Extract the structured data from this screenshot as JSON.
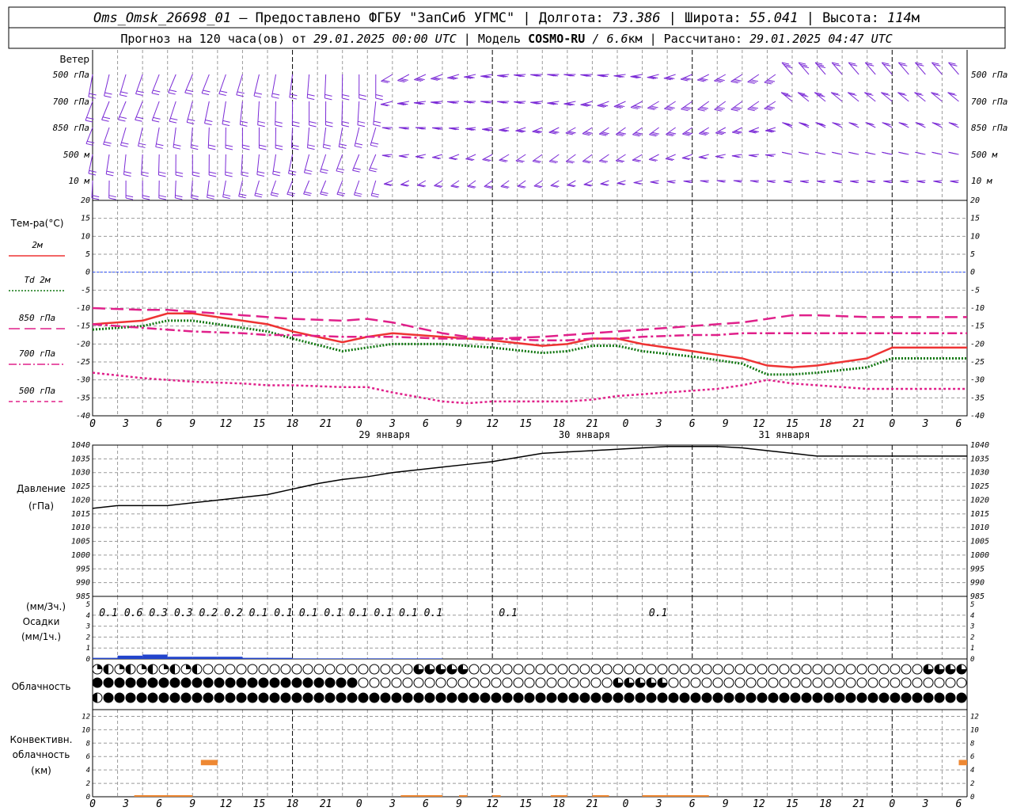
{
  "header": {
    "line1": [
      {
        "t": "Oms_Omsk_26698_01",
        "it": true
      },
      {
        "t": " – Предоставлено ФГБУ \"ЗапСиб УГМС\" | Долгота: ",
        "it": false
      },
      {
        "t": "73.386",
        "it": true
      },
      {
        "t": " | Широта: ",
        "it": false
      },
      {
        "t": "55.041",
        "it": true
      },
      {
        "t": " | Высота: ",
        "it": false
      },
      {
        "t": "114",
        "it": true
      },
      {
        "t": "м",
        "it": false
      }
    ],
    "line2": [
      {
        "t": "Прогноз на 120 часа(ов) от ",
        "it": false
      },
      {
        "t": "29.01.2025 00:00 UTC",
        "it": true
      },
      {
        "t": " | Модель ",
        "it": false
      },
      {
        "t": "COSMO-RU",
        "it": false,
        "b": true
      },
      {
        "t": " / ",
        "it": true
      },
      {
        "t": "6.6",
        "it": true
      },
      {
        "t": "км | Рассчитано: ",
        "it": false
      },
      {
        "t": "29.01.2025 04:47 UTC",
        "it": true
      }
    ]
  },
  "wind": {
    "title": "Ветер",
    "levels": [
      "500 гПа",
      "700 гПа",
      "850 гПа",
      "500 м",
      "10 м"
    ],
    "color": "#7b2bd6"
  },
  "temperature": {
    "ylabel": "Тем-ра(°С)",
    "legend": [
      {
        "label": "2м",
        "color": "#ee3333",
        "dash": "solid"
      },
      {
        "label": "Td 2м",
        "color": "#117711",
        "dash": "dotted"
      },
      {
        "label": "850 гПа",
        "color": "#e0208a",
        "dash": "long"
      },
      {
        "label": "700 гПа",
        "color": "#e0208a",
        "dash": "dashdot"
      },
      {
        "label": "500 гПа",
        "color": "#e0208a",
        "dash": "short"
      }
    ],
    "ticks": [
      "20",
      "15",
      "10",
      "5",
      "0",
      "-5",
      "-10",
      "-15",
      "-20",
      "-25",
      "-30",
      "-35",
      "-40"
    ]
  },
  "hour_ticks": [
    "0",
    "3",
    "6",
    "9",
    "12",
    "15",
    "18",
    "21",
    "0",
    "3",
    "6",
    "9",
    "12",
    "15",
    "18",
    "21",
    "0",
    "3",
    "6",
    "9",
    "12",
    "15",
    "18",
    "21",
    "0",
    "3",
    "6"
  ],
  "day_labels": [
    "29 января",
    "30 января",
    "31 января"
  ],
  "pressure": {
    "ylabel_1": "Давление",
    "ylabel_2": "(гПа)",
    "ticks": [
      "1040",
      "1035",
      "1030",
      "1025",
      "1020",
      "1015",
      "1010",
      "1005",
      "1000",
      "995",
      "990",
      "985"
    ]
  },
  "precip": {
    "ylabel_1": "(мм/3ч.)",
    "ylabel_2": "Осадки",
    "ylabel_3": "(мм/1ч.)",
    "ticks": [
      "5",
      "4",
      "3",
      "2",
      "1",
      "0"
    ],
    "amounts": [
      "0.1",
      "0.6",
      "0.3",
      "0.3",
      "0.2",
      "0.2",
      "0.1",
      "0.1",
      "0.1",
      "0.1",
      "0.1",
      "0.1",
      "0.1",
      "0.1",
      "0.1",
      "0.1"
    ]
  },
  "clouds": {
    "label": "Облачность"
  },
  "convective": {
    "ylabel_1": "Конвективн.",
    "ylabel_2": "облачность",
    "ylabel_3": "(км)",
    "ticks": [
      "12",
      "10",
      "8",
      "6",
      "4",
      "2",
      "0"
    ]
  },
  "chart_data": [
    {
      "type": "line",
      "title": "Температура",
      "x_hours": [
        0,
        6,
        9,
        12,
        18,
        21,
        24,
        30,
        33,
        36,
        42,
        45,
        48,
        54,
        57,
        60,
        63,
        66,
        72,
        75,
        78,
        81,
        84,
        87,
        93,
        96,
        102,
        105
      ],
      "ylim": [
        -40,
        20
      ],
      "series": [
        {
          "name": "2м",
          "values": [
            -14.5,
            -13.5,
            -11.5,
            -11.5,
            -13.5,
            -14.5,
            -16.5,
            -19.5,
            -18,
            -17,
            -18,
            -18.5,
            -19,
            -20.5,
            -20,
            -18.5,
            -18.5,
            -20,
            -22,
            -23,
            -24,
            -26,
            -26.5,
            -26,
            -24,
            -21,
            -21,
            -21
          ]
        },
        {
          "name": "Td 2м",
          "values": [
            -16,
            -15,
            -13.5,
            -13.5,
            -15.5,
            -16.5,
            -18.5,
            -22,
            -21,
            -20,
            -20,
            -20.5,
            -21,
            -22.5,
            -22,
            -20.5,
            -20.5,
            -22,
            -23.5,
            -24.5,
            -25.5,
            -28.5,
            -28.5,
            -28,
            -26.5,
            -24,
            -24,
            -24
          ]
        },
        {
          "name": "850 гПа",
          "values": [
            -10,
            -10.5,
            -10.5,
            -11,
            -12,
            -12.5,
            -13,
            -13.5,
            -13,
            -14,
            -17,
            -18,
            -18.5,
            -18,
            -17.5,
            -17,
            -16.5,
            -16,
            -15,
            -14.5,
            -14,
            -13,
            -12,
            -12,
            -12.5,
            -12.5,
            -12.5,
            -12.5
          ]
        },
        {
          "name": "700 гПа",
          "values": [
            -14.5,
            -15.5,
            -16,
            -16.5,
            -17,
            -17.5,
            -17.5,
            -18,
            -18,
            -18,
            -18.5,
            -18.5,
            -18.5,
            -19,
            -19,
            -18.5,
            -18.5,
            -18,
            -17.5,
            -17.5,
            -17,
            -17,
            -17,
            -17,
            -17,
            -17,
            -17,
            -17
          ]
        },
        {
          "name": "500 гПа",
          "values": [
            -28,
            -29.5,
            -30,
            -30.5,
            -31,
            -31.5,
            -31.5,
            -32,
            -32,
            -33.5,
            -36,
            -36.5,
            -36,
            -36,
            -36,
            -35.5,
            -34.5,
            -34,
            -33,
            -32.5,
            -31.5,
            -30,
            -31,
            -31.5,
            -32.5,
            -32.5,
            -32.5,
            -32.5
          ]
        }
      ]
    },
    {
      "type": "line",
      "title": "Давление",
      "x_hours": [
        0,
        3,
        6,
        9,
        12,
        15,
        18,
        21,
        24,
        27,
        30,
        33,
        36,
        39,
        42,
        45,
        48,
        51,
        54,
        57,
        60,
        63,
        66,
        69,
        72,
        75,
        78,
        81,
        84,
        87,
        90,
        93,
        96,
        99,
        102,
        105
      ],
      "ylim": [
        985,
        1040
      ],
      "series": [
        {
          "name": "Давление",
          "values": [
            1017,
            1018,
            1018,
            1018,
            1019,
            1020,
            1021,
            1022,
            1024,
            1026,
            1027.5,
            1028.5,
            1030,
            1031,
            1032,
            1033,
            1034,
            1035.5,
            1037,
            1037.5,
            1038,
            1038.5,
            1039,
            1039.5,
            1039.5,
            1039.5,
            1039,
            1038,
            1037,
            1036,
            1036,
            1036,
            1036,
            1036,
            1036,
            1036
          ]
        }
      ]
    },
    {
      "type": "bar",
      "title": "Осадки",
      "x_hours": [
        0,
        3,
        6,
        9,
        12,
        15,
        18,
        21,
        24,
        27,
        30,
        33,
        36,
        39
      ],
      "ylim": [
        0,
        5
      ],
      "values": [
        0.1,
        0.3,
        0.4,
        0.2,
        0.2,
        0.2,
        0.1,
        0.1,
        0.05,
        0.05,
        0.05,
        0.05,
        0.05,
        0.05
      ]
    },
    {
      "type": "bar",
      "title": "Конвективная облачность",
      "ylim": [
        0,
        13
      ],
      "segments": [
        {
          "x0": 13,
          "x1": 15,
          "bottom": 4.7,
          "top": 5.5
        },
        {
          "x0": 104,
          "x1": 105,
          "bottom": 4.7,
          "top": 5.5
        }
      ]
    }
  ],
  "colors": {
    "wind": "#7b2bd6",
    "t2m": "#ee3333",
    "td": "#117711",
    "upper": "#e0208a",
    "precip": "#2244cc",
    "conv": "#ee8833",
    "zero": "#3355ff"
  }
}
